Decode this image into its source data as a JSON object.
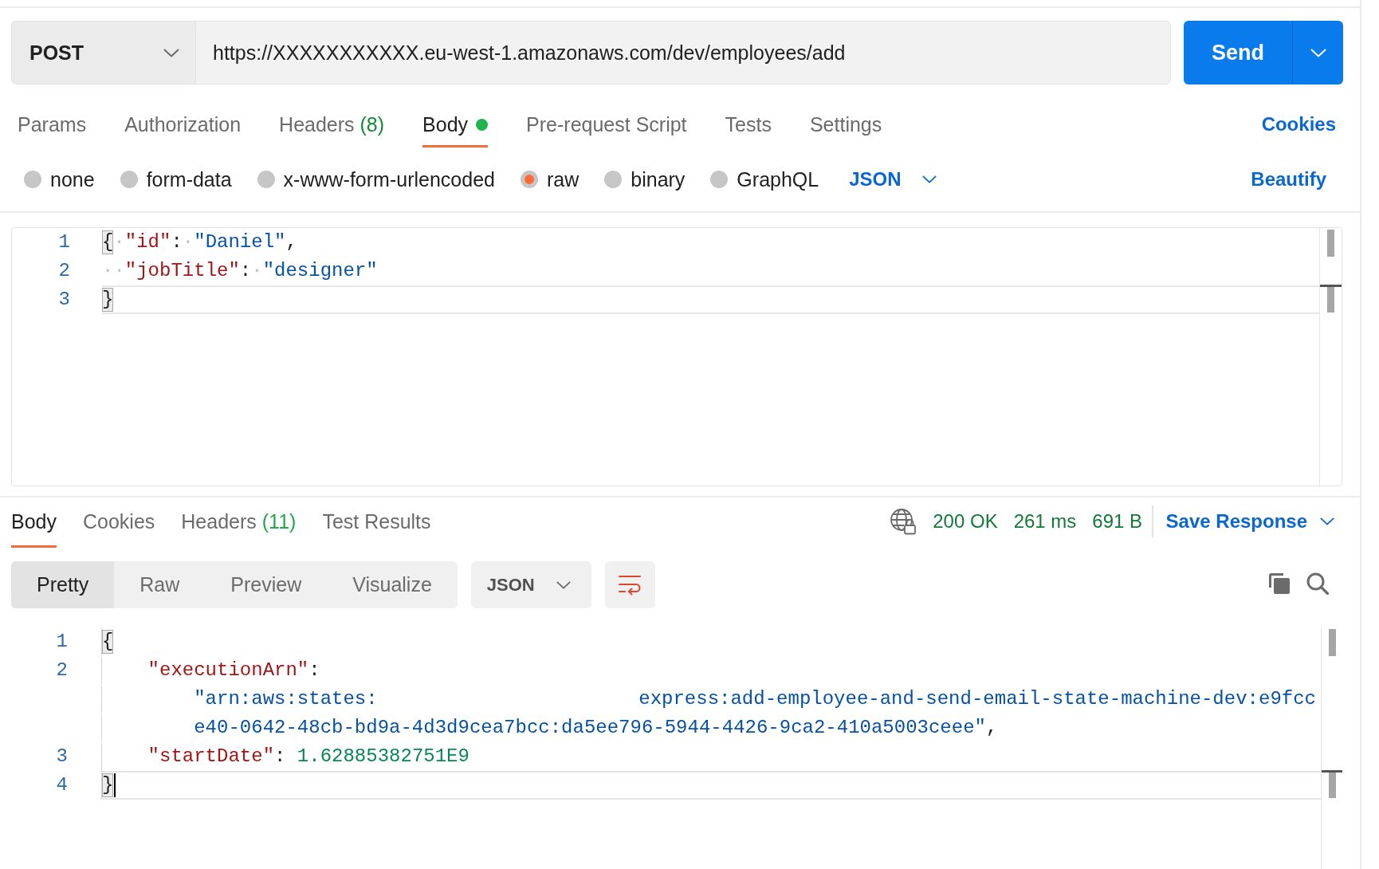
{
  "request": {
    "method": "POST",
    "url": "https://XXXXXXXXXXX.eu-west-1.amazonaws.com/dev/employees/add",
    "send": "Send",
    "tabs": [
      {
        "label": "Params",
        "selected": false,
        "modified": false
      },
      {
        "label": "Authorization",
        "selected": false,
        "modified": false
      },
      {
        "label": "Headers",
        "count": "(8)",
        "selected": false,
        "modified": false
      },
      {
        "label": "Body",
        "selected": true,
        "modified": true
      },
      {
        "label": "Pre-request Script",
        "selected": false,
        "modified": false
      },
      {
        "label": "Tests",
        "selected": false,
        "modified": false
      },
      {
        "label": "Settings",
        "selected": false,
        "modified": false
      }
    ],
    "cookies": "Cookies",
    "body_types": [
      {
        "label": "none",
        "selected": false
      },
      {
        "label": "form-data",
        "selected": false
      },
      {
        "label": "x-www-form-urlencoded",
        "selected": false
      },
      {
        "label": "raw",
        "selected": true
      },
      {
        "label": "binary",
        "selected": false
      },
      {
        "label": "GraphQL",
        "selected": false
      }
    ],
    "language": "JSON",
    "beautify": "Beautify",
    "editor": {
      "focused": false,
      "lines": [
        {
          "number": "1",
          "kind": "line",
          "active": false,
          "tokens": [
            {
              "kind": "bracket",
              "text": "{"
            },
            {
              "kind": "space",
              "text": "·"
            },
            {
              "kind": "key",
              "text": "\"id\""
            },
            {
              "kind": "punct",
              "text": ":"
            },
            {
              "kind": "space",
              "text": "·"
            },
            {
              "kind": "string",
              "text": "\"Daniel\""
            },
            {
              "kind": "punct",
              "text": ","
            }
          ]
        },
        {
          "number": "2",
          "kind": "line",
          "active": false,
          "tokens": [
            {
              "kind": "space",
              "text": "··"
            },
            {
              "kind": "key",
              "text": "\"jobTitle\""
            },
            {
              "kind": "punct",
              "text": ":"
            },
            {
              "kind": "space",
              "text": "·"
            },
            {
              "kind": "string",
              "text": "\"designer\""
            }
          ]
        },
        {
          "number": "3",
          "kind": "line",
          "active": true,
          "tokens": [
            {
              "kind": "bracket",
              "text": "}"
            }
          ]
        }
      ]
    }
  },
  "response": {
    "tabs": [
      {
        "label": "Body",
        "selected": true
      },
      {
        "label": "Cookies",
        "selected": false
      },
      {
        "label": "Headers",
        "count": "(11)",
        "selected": false
      },
      {
        "label": "Test Results",
        "selected": false
      }
    ],
    "status": "200 OK",
    "time": "261 ms",
    "size": "691 B",
    "save": "Save Response",
    "views": [
      {
        "label": "Pretty",
        "selected": true
      },
      {
        "label": "Raw",
        "selected": false
      },
      {
        "label": "Preview",
        "selected": false
      },
      {
        "label": "Visualize",
        "selected": false
      }
    ],
    "format": "JSON",
    "wrap_lines": {
      "on": true
    },
    "editor": {
      "focused": true,
      "lines": [
        {
          "number": "1",
          "kind": "line",
          "active": false,
          "tokens": [
            {
              "kind": "bracket",
              "text": "{"
            }
          ],
          "children": [
            {
              "number": "2",
              "kind": "line",
              "active": false,
              "tokens": [
                {
                  "kind": "key",
                  "text": "\"executionArn\""
                },
                {
                  "kind": "punct",
                  "text": ":"
                }
              ],
              "children": [
                {
                  "kind": "spread",
                  "active": false,
                  "tokens": [
                    {
                      "kind": "string",
                      "text": "\"arn:aws:states:"
                    },
                    {
                      "kind": "string",
                      "text": "express:add-employee-and-send-email-state-machine-dev:e9fcc"
                    }
                  ]
                },
                {
                  "kind": "line",
                  "active": false,
                  "tokens": [
                    {
                      "kind": "string",
                      "text": "e40-0642-48cb-bd9a-4d3d9cea7bcc:da5ee796-5944-4426-9ca2-410a5003ceee\""
                    },
                    {
                      "kind": "punct",
                      "text": ","
                    }
                  ]
                }
              ]
            },
            {
              "number": "3",
              "kind": "line",
              "active": false,
              "tokens": [
                {
                  "kind": "key",
                  "text": "\"startDate\""
                },
                {
                  "kind": "punct",
                  "text": ": "
                },
                {
                  "kind": "number",
                  "text": "1.62885382751E9"
                }
              ]
            }
          ]
        },
        {
          "number": "4",
          "kind": "line",
          "active": true,
          "tokens": [
            {
              "kind": "bracket",
              "text": "}"
            }
          ]
        }
      ]
    }
  }
}
